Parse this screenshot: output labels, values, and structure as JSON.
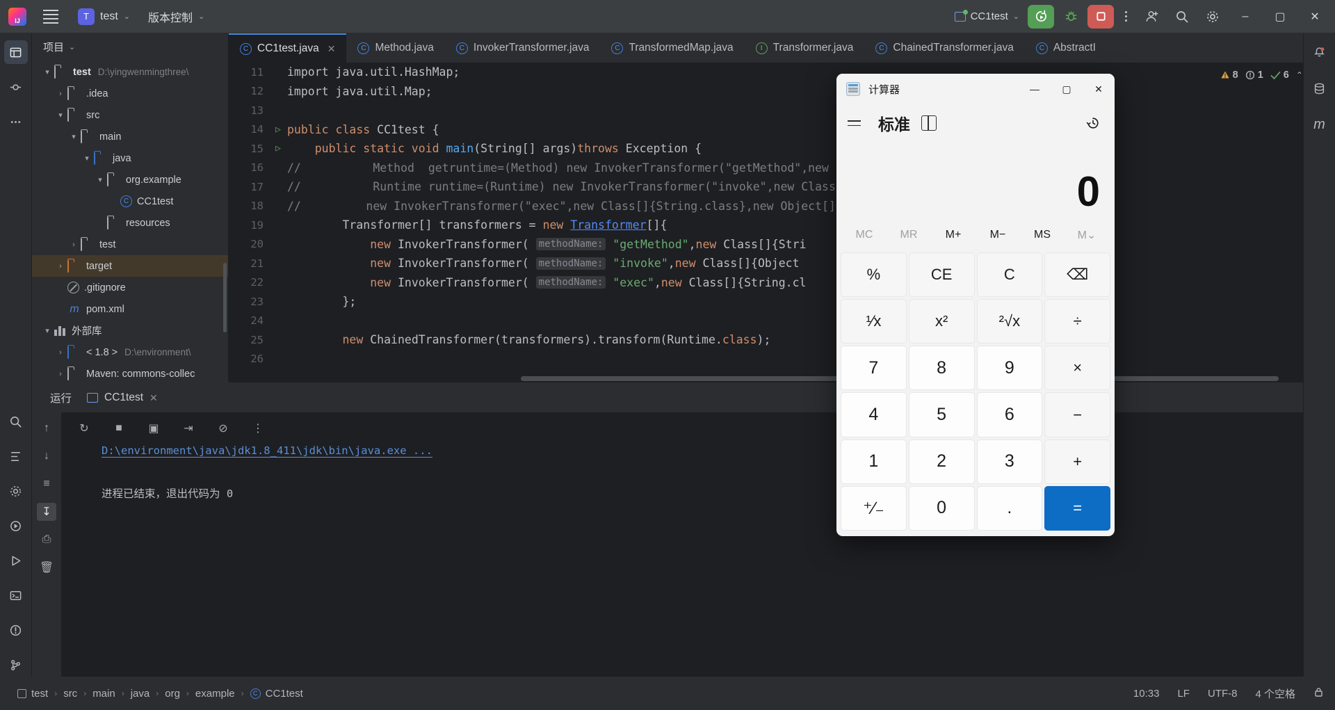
{
  "titlebar": {
    "menu_icon": "hamburger-icon",
    "project_badge": "T",
    "project_name": "test",
    "vcs_label": "版本控制",
    "run_config": "CC1test",
    "run_icon": "run-with-coverage-icon",
    "debug_icon": "debug-bug-icon",
    "stop_icon": "stop-square-icon",
    "more_icon": "more-vertical-icon",
    "account_icon": "user-account-icon",
    "search_icon": "search-icon",
    "settings_icon": "gear-icon",
    "minimize": "–",
    "maximize": "▢",
    "close": "✕"
  },
  "activitybar": {
    "items": [
      {
        "name": "project-tool-icon",
        "glyph": "▤"
      },
      {
        "name": "commit-tool-icon",
        "glyph": "⌸"
      },
      {
        "name": "more-tool-icon",
        "glyph": "⋯"
      },
      {
        "name": "find-tool-icon",
        "glyph": "⌕"
      },
      {
        "name": "structure-tool-icon",
        "glyph": "↧"
      },
      {
        "name": "problems-tool-icon",
        "glyph": "⚙"
      },
      {
        "name": "services-tool-icon",
        "glyph": "▶"
      },
      {
        "name": "run-tool-icon",
        "glyph": "▷"
      },
      {
        "name": "terminal-tool-icon",
        "glyph": "▭"
      },
      {
        "name": "notifications-tool-icon",
        "glyph": "!"
      },
      {
        "name": "git-tool-icon",
        "glyph": "⑂"
      }
    ]
  },
  "project_panel": {
    "title": "项目",
    "tree": [
      {
        "depth": 0,
        "arrow": "▾",
        "icon": "module-folder",
        "label": "test",
        "bold": true,
        "path": "D:\\yingwenmingthree\\"
      },
      {
        "depth": 1,
        "arrow": "›",
        "icon": "folder",
        "label": ".idea",
        "path": ""
      },
      {
        "depth": 1,
        "arrow": "▾",
        "icon": "folder",
        "label": "src",
        "path": ""
      },
      {
        "depth": 2,
        "arrow": "▾",
        "icon": "folder",
        "label": "main",
        "path": ""
      },
      {
        "depth": 3,
        "arrow": "▾",
        "icon": "folder-blue",
        "label": "java",
        "path": ""
      },
      {
        "depth": 4,
        "arrow": "▾",
        "icon": "package",
        "label": "org.example",
        "path": ""
      },
      {
        "depth": 5,
        "arrow": "",
        "icon": "class",
        "label": "CC1test",
        "path": ""
      },
      {
        "depth": 4,
        "arrow": "",
        "icon": "resource-folder",
        "label": "resources",
        "path": ""
      },
      {
        "depth": 2,
        "arrow": "›",
        "icon": "folder",
        "label": "test",
        "path": ""
      },
      {
        "depth": 1,
        "arrow": "›",
        "icon": "folder-orange",
        "label": "target",
        "path": "",
        "selected": true
      },
      {
        "depth": 1,
        "arrow": "",
        "icon": "gitignore",
        "label": ".gitignore",
        "path": ""
      },
      {
        "depth": 1,
        "arrow": "",
        "icon": "maven",
        "label": "pom.xml",
        "path": ""
      },
      {
        "depth": 0,
        "arrow": "▾",
        "icon": "library",
        "label": "外部库",
        "path": ""
      },
      {
        "depth": 1,
        "arrow": "›",
        "icon": "jdk",
        "label": "< 1.8 >",
        "path": "D:\\environment\\"
      },
      {
        "depth": 1,
        "arrow": "›",
        "icon": "folder",
        "label": "Maven: commons-collec",
        "path": ""
      }
    ]
  },
  "tabs": [
    {
      "label": "CC1test.java",
      "type": "class",
      "active": true,
      "closable": true
    },
    {
      "label": "Method.java",
      "type": "class",
      "active": false,
      "closable": false
    },
    {
      "label": "InvokerTransformer.java",
      "type": "class",
      "active": false,
      "closable": false
    },
    {
      "label": "TransformedMap.java",
      "type": "class",
      "active": false,
      "closable": false
    },
    {
      "label": "Transformer.java",
      "type": "interface",
      "active": false,
      "closable": false
    },
    {
      "label": "ChainedTransformer.java",
      "type": "class",
      "active": false,
      "closable": false
    },
    {
      "label": "AbstractI",
      "type": "class",
      "active": false,
      "closable": false
    }
  ],
  "tabs_right": {
    "chevron_icon": "chevron-down-icon",
    "kebab_icon": "more-vertical-icon"
  },
  "inspection": {
    "warnings": "8",
    "weak_warnings": "1",
    "checks": "6",
    "warn_icon": "warning-triangle-icon",
    "weak_icon": "weak-warning-icon",
    "ok_icon": "checkmark-icon",
    "up_icon": "chevron-up-icon",
    "down_icon": "chevron-down-icon"
  },
  "code": [
    {
      "no": "11",
      "run": false,
      "parts": [
        {
          "t": "import java.util.HashMap;",
          "c": "ctext"
        }
      ],
      "indent": 0
    },
    {
      "no": "12",
      "run": false,
      "parts": [
        {
          "t": "import java.util.Map;",
          "c": "ctext"
        }
      ],
      "indent": 0
    },
    {
      "no": "13",
      "run": false,
      "parts": [],
      "indent": 0
    },
    {
      "no": "14",
      "run": true,
      "parts": [
        {
          "t": "public class ",
          "c": "kw"
        },
        {
          "t": "CC1test {",
          "c": "ctext"
        }
      ],
      "indent": 0
    },
    {
      "no": "15",
      "run": true,
      "parts": [
        {
          "t": "    public static void ",
          "c": "kw"
        },
        {
          "t": "main",
          "c": "fn"
        },
        {
          "t": "(String[] args)",
          "c": "ctext"
        },
        {
          "t": "throws ",
          "c": "kw"
        },
        {
          "t": "Exception {",
          "c": "ctext"
        }
      ],
      "indent": 0
    },
    {
      "no": "16",
      "run": false,
      "comment": "//",
      "parts": [
        {
          "t": "        Method  getruntime=(Method) new InvokerTransformer(\"getMethod\",new Class[]{\"getRuntime\",null})",
          "c": "cmt"
        }
      ],
      "indent": 0
    },
    {
      "no": "17",
      "run": false,
      "comment": "//",
      "parts": [
        {
          "t": "        Runtime runtime=(Runtime) new InvokerTransformer(\"invoke\",new Class[]{null,null}).transform(",
          "c": "cmt"
        }
      ],
      "indent": 0
    },
    {
      "no": "18",
      "run": false,
      "comment": "//",
      "parts": [
        {
          "t": "       new InvokerTransformer(\"exec\",new Class[]{String.class},new Object[]",
          "c": "cmt"
        }
      ],
      "indent": 0
    },
    {
      "no": "19",
      "run": false,
      "parts": [
        {
          "t": "        Transformer[] transformers = ",
          "c": "ctext"
        },
        {
          "t": "new ",
          "c": "kw"
        },
        {
          "t": "Transformer",
          "c": "lnk"
        },
        {
          "t": "[]{",
          "c": "ctext"
        }
      ],
      "indent": 0
    },
    {
      "no": "20",
      "run": false,
      "parts": [
        {
          "t": "            new ",
          "c": "kw"
        },
        {
          "t": "InvokerTransformer( ",
          "c": "ctext"
        },
        {
          "t": "methodName:",
          "c": "hint"
        },
        {
          "t": " ",
          "c": "ctext"
        },
        {
          "t": "\"getMethod\"",
          "c": "str"
        },
        {
          "t": ",",
          "c": "ctext"
        },
        {
          "t": "new ",
          "c": "kw"
        },
        {
          "t": "Class[]{Stri",
          "c": "ctext"
        }
      ],
      "indent": 0
    },
    {
      "no": "21",
      "run": false,
      "parts": [
        {
          "t": "            new ",
          "c": "kw"
        },
        {
          "t": "InvokerTransformer( ",
          "c": "ctext"
        },
        {
          "t": "methodName:",
          "c": "hint"
        },
        {
          "t": " ",
          "c": "ctext"
        },
        {
          "t": "\"invoke\"",
          "c": "str"
        },
        {
          "t": ",",
          "c": "ctext"
        },
        {
          "t": "new ",
          "c": "kw"
        },
        {
          "t": "Class[]{Object",
          "c": "ctext"
        }
      ],
      "indent": 0
    },
    {
      "no": "22",
      "run": false,
      "parts": [
        {
          "t": "            new ",
          "c": "kw"
        },
        {
          "t": "InvokerTransformer( ",
          "c": "ctext"
        },
        {
          "t": "methodName:",
          "c": "hint"
        },
        {
          "t": " ",
          "c": "ctext"
        },
        {
          "t": "\"exec\"",
          "c": "str"
        },
        {
          "t": ",",
          "c": "ctext"
        },
        {
          "t": "new ",
          "c": "kw"
        },
        {
          "t": "Class[]{String.cl",
          "c": "ctext"
        }
      ],
      "indent": 0
    },
    {
      "no": "23",
      "run": false,
      "parts": [
        {
          "t": "        };",
          "c": "ctext"
        }
      ],
      "indent": 0
    },
    {
      "no": "24",
      "run": false,
      "parts": [],
      "indent": 0
    },
    {
      "no": "25",
      "run": false,
      "parts": [
        {
          "t": "        new ",
          "c": "kw"
        },
        {
          "t": "ChainedTransformer(transformers).transform(Runtime.",
          "c": "ctext"
        },
        {
          "t": "class",
          "c": "kw"
        },
        {
          "t": ");",
          "c": "ctext"
        }
      ],
      "indent": 0
    },
    {
      "no": "26",
      "run": false,
      "parts": [],
      "indent": 0
    }
  ],
  "run_panel": {
    "title": "运行",
    "tab_label": "CC1test",
    "close_icon": "close-icon",
    "toolbar_icons": [
      {
        "name": "rerun-icon",
        "glyph": "↻"
      },
      {
        "name": "stop-icon",
        "glyph": "■"
      },
      {
        "name": "camera-icon",
        "glyph": "▣"
      },
      {
        "name": "export-icon",
        "glyph": "⇥"
      },
      {
        "name": "filter-icon",
        "glyph": "⊘"
      },
      {
        "name": "more-icon",
        "glyph": "⋮"
      }
    ],
    "side_icons": [
      {
        "name": "scroll-up-icon",
        "glyph": "↑"
      },
      {
        "name": "scroll-down-icon",
        "glyph": "↓"
      },
      {
        "name": "soft-wrap-icon",
        "glyph": "≡"
      },
      {
        "name": "scroll-to-end-icon",
        "glyph": "↧",
        "active": true
      },
      {
        "name": "print-icon",
        "glyph": "⎙"
      },
      {
        "name": "clear-all-icon",
        "glyph": "🗑"
      }
    ],
    "command_line": "D:\\environment\\java\\jdk1.8_411\\jdk\\bin\\java.exe ...",
    "output": "进程已结束，退出代码为 0"
  },
  "statusbar": {
    "breadcrumbs": [
      {
        "label": "test",
        "icon": "module-icon"
      },
      {
        "label": "src",
        "icon": ""
      },
      {
        "label": "main",
        "icon": ""
      },
      {
        "label": "java",
        "icon": ""
      },
      {
        "label": "org",
        "icon": ""
      },
      {
        "label": "example",
        "icon": ""
      },
      {
        "label": "CC1test",
        "icon": "class-icon"
      }
    ],
    "separator": "›",
    "position": "10:33",
    "line_sep": "LF",
    "encoding": "UTF-8",
    "indent": "4 个空格"
  },
  "right_rail": {
    "items": [
      {
        "name": "notifications-icon",
        "glyph": "🔔"
      },
      {
        "name": "database-icon",
        "glyph": "⛁"
      },
      {
        "name": "maven-icon",
        "glyph": "m"
      }
    ]
  },
  "calculator": {
    "window_title": "计算器",
    "app_icon": "calculator-icon",
    "minimize_label": "—",
    "maximize_label": "▢",
    "close_label": "✕",
    "menu_icon": "hamburger-menu-icon",
    "mode_label": "标准",
    "keep_on_top_icon": "keep-on-top-icon",
    "history_icon": "history-clock-icon",
    "display_value": "0",
    "memory_buttons": [
      {
        "label": "MC",
        "disabled": true
      },
      {
        "label": "MR",
        "disabled": true
      },
      {
        "label": "M+",
        "disabled": false
      },
      {
        "label": "M−",
        "disabled": false
      },
      {
        "label": "MS",
        "disabled": false
      },
      {
        "label": "M⌄",
        "disabled": true
      }
    ],
    "keys": [
      {
        "label": "%",
        "kind": "dim",
        "name": "percent-key"
      },
      {
        "label": "CE",
        "kind": "dim",
        "name": "clear-entry-key"
      },
      {
        "label": "C",
        "kind": "dim",
        "name": "clear-key"
      },
      {
        "label": "⌫",
        "kind": "dim",
        "name": "backspace-key"
      },
      {
        "label": "¹⁄x",
        "kind": "dim",
        "name": "reciprocal-key"
      },
      {
        "label": "x²",
        "kind": "dim",
        "name": "square-key"
      },
      {
        "label": "²√x",
        "kind": "dim",
        "name": "square-root-key"
      },
      {
        "label": "÷",
        "kind": "dim",
        "name": "divide-key"
      },
      {
        "label": "7",
        "kind": "num",
        "name": "seven-key"
      },
      {
        "label": "8",
        "kind": "num",
        "name": "eight-key"
      },
      {
        "label": "9",
        "kind": "num",
        "name": "nine-key"
      },
      {
        "label": "×",
        "kind": "dim",
        "name": "multiply-key"
      },
      {
        "label": "4",
        "kind": "num",
        "name": "four-key"
      },
      {
        "label": "5",
        "kind": "num",
        "name": "five-key"
      },
      {
        "label": "6",
        "kind": "num",
        "name": "six-key"
      },
      {
        "label": "−",
        "kind": "dim",
        "name": "subtract-key"
      },
      {
        "label": "1",
        "kind": "num",
        "name": "one-key"
      },
      {
        "label": "2",
        "kind": "num",
        "name": "two-key"
      },
      {
        "label": "3",
        "kind": "num",
        "name": "three-key"
      },
      {
        "label": "+",
        "kind": "dim",
        "name": "add-key"
      },
      {
        "label": "⁺∕₋",
        "kind": "num",
        "name": "sign-key"
      },
      {
        "label": "0",
        "kind": "num",
        "name": "zero-key"
      },
      {
        "label": ".",
        "kind": "num",
        "name": "decimal-key"
      },
      {
        "label": "=",
        "kind": "eq",
        "name": "equals-key"
      }
    ]
  }
}
